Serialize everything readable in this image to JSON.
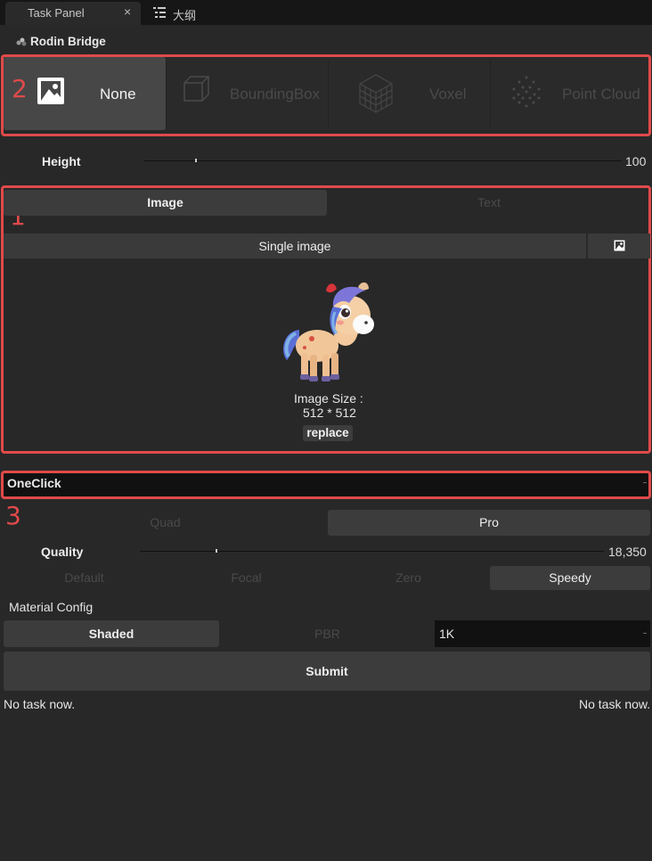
{
  "tabs": [
    {
      "label": "Task Panel",
      "close": "×"
    },
    {
      "label": "大纲"
    }
  ],
  "panel_title": "Rodin Bridge",
  "modes": [
    {
      "label": "None",
      "active": true,
      "icon": "image-icon"
    },
    {
      "label": "BoundingBox",
      "active": false,
      "icon": "cube-icon"
    },
    {
      "label": "Voxel",
      "active": false,
      "icon": "voxel-icon"
    },
    {
      "label": "Point Cloud",
      "active": false,
      "icon": "point-cloud-icon"
    }
  ],
  "height": {
    "label": "Height",
    "value": "100",
    "level": 0.11
  },
  "annotations": [
    "1",
    "2",
    "3"
  ],
  "input_type": {
    "image": "Image",
    "text": "Text",
    "active": "image"
  },
  "image_mode": {
    "label": "Single image",
    "icon": "image-picker-icon"
  },
  "preview": {
    "size_label": "Image Size :",
    "size_value": "512 * 512",
    "replace": "replace"
  },
  "pipeline": {
    "value": "OneClick"
  },
  "mesh": {
    "quad": "Quad",
    "pro": "Pro",
    "active": "pro"
  },
  "quality": {
    "label": "Quality",
    "value": "18,350",
    "level": 0.16
  },
  "presets": {
    "items": [
      "Default",
      "Focal",
      "Zero",
      "Speedy"
    ],
    "active": "Speedy"
  },
  "material": {
    "title": "Material Config",
    "shaded": "Shaded",
    "pbr": "PBR",
    "resolution": "1K",
    "active": "Shaded"
  },
  "submit": "Submit",
  "status": {
    "left": "No task now.",
    "right": "No task now."
  },
  "colors": {
    "highlight": "#e04a4a",
    "active_button": "#474747",
    "background": "#282828"
  }
}
